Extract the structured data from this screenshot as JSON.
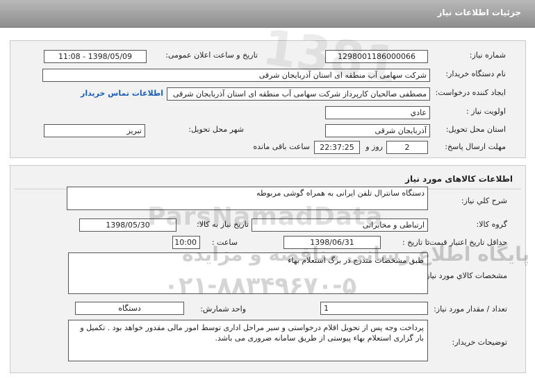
{
  "header": {
    "title": "جزئیات اطلاعات نیاز"
  },
  "need_info": {
    "need_number_label": "شماره نیاز:",
    "need_number": "1298001186000066",
    "announce_label": "تاریخ و ساعت اعلان عمومی:",
    "announce_value": "1398/05/09 - 11:08",
    "buyer_label": "نام دستگاه خریدار:",
    "buyer_value": "شرکت سهامی آب منطقه ای استان آذربایجان شرقی",
    "creator_label": "ایجاد کننده درخواست:",
    "creator_value": "مصطفی صالحیان کارپرداز شرکت سهامی آب منطقه ای استان آذربایجان شرقی",
    "contact_link": "اطلاعات تماس خریدار",
    "priority_label": "اولویت نیاز :",
    "priority_value": "عادي",
    "province_label": "استان محل تحویل:",
    "province_value": "آذربایجان شرقی",
    "city_label": "شهر محل تحویل:",
    "city_value": "تبریز",
    "deadline_label": "مهلت ارسال پاسخ:",
    "deadline_days": "2",
    "deadline_days_unit": "روز و",
    "deadline_time": "22:37:25",
    "deadline_remaining": "ساعت باقی مانده"
  },
  "goods": {
    "section_title": "اطلاعات کالاهای مورد نیاز",
    "summary_label": "شرح کلي نیاز:",
    "summary_value": "دستگاه سانترال تلفن ایرانی به همراه گوشی مربوطه",
    "group_label": "گروه کالا:",
    "group_value": "ارتباطی و مخابراتی",
    "need_date_label": "تاریخ نیاز به کالا:",
    "need_date_value": "1398/05/30",
    "validity_label": "حداقل تاریخ اعتبار قیمت:",
    "validity_until": "تا تاریخ :",
    "validity_date": "1398/06/31",
    "validity_time_label": "ساعت :",
    "validity_time": "10:00",
    "specs_label": "مشخصات کالاي مورد نیاز:",
    "specs_value": "طبق مشخصات مندرج در برگ استعلام بهاء",
    "quantity_label": "تعداد / مقدار مورد نیاز:",
    "quantity_value": "1",
    "unit_label": "واحد شمارش:",
    "unit_value": "دستگاه",
    "notes_label": "توضیحات خریدار:",
    "notes_value": "پرداخت وجه پس از تحویل اقلام درخواستی و سیر مراحل اداری توسط امور مالی مقدور خواهد بود . تکمیل و بار گزاری استعلام بهاء پیوستی از طریق سامانه ضروری می باشد."
  },
  "watermark": {
    "brand": "ParsNamadData",
    "tagline": "پایگاه اطلاع رسانی مناقصه و مزایده",
    "phone": "۰۲۱-۸۸۳۴۹۶۷۰-۵",
    "number": "1381"
  }
}
